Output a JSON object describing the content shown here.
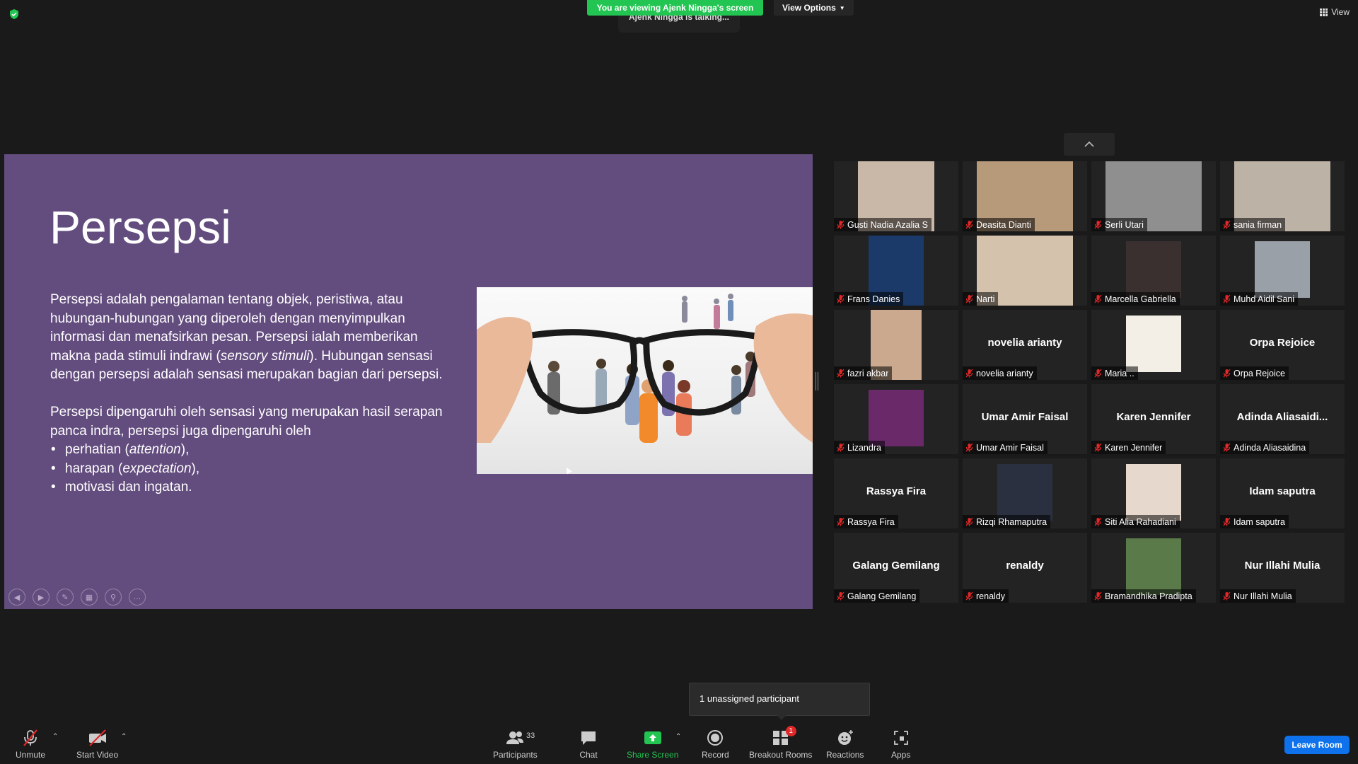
{
  "top": {
    "viewing_banner": "You are viewing Ajenk Ningga's screen",
    "view_options": "View Options",
    "talking": "Ajenk Ningga is talking...",
    "view_label": "View"
  },
  "slide": {
    "title": "Persepsi",
    "para1_a": "Persepsi adalah pengalaman tentang objek, peristiwa, atau hubungan-hubungan yang diperoleh dengan menyimpulkan informasi dan menafsirkan pesan. Persepsi ialah memberikan makna pada stimuli indrawi (",
    "para1_em": "sensory stimuli",
    "para1_b": "). Hubungan sensasi dengan persepsi adalah sensasi merupakan bagian dari persepsi.",
    "para2": "Persepsi dipengaruhi oleh sensasi yang merupakan hasil serapan panca indra, persepsi juga dipengaruhi oleh",
    "bullets": [
      {
        "a": "perhatian (",
        "em": "attention",
        "b": "),"
      },
      {
        "a": "harapan (",
        "em": "expectation",
        "b": "),"
      },
      {
        "a": "motivasi dan ingatan.",
        "em": "",
        "b": ""
      }
    ]
  },
  "gallery": {
    "tiles": [
      {
        "label": "Gusti Nadia Azalia S",
        "center": ""
      },
      {
        "label": "Deasita Dianti",
        "center": ""
      },
      {
        "label": "Serli Utari",
        "center": ""
      },
      {
        "label": "sania firman",
        "center": ""
      },
      {
        "label": "Frans Danies",
        "center": ""
      },
      {
        "label": "Narti",
        "center": ""
      },
      {
        "label": "Marcella Gabriella",
        "center": ""
      },
      {
        "label": "Muhd Aidil Sani",
        "center": ""
      },
      {
        "label": "fazri akbar",
        "center": ""
      },
      {
        "label": "novelia arianty",
        "center": "novelia arianty"
      },
      {
        "label": "Maria ..",
        "center": ""
      },
      {
        "label": "Orpa Rejoice",
        "center": "Orpa Rejoice"
      },
      {
        "label": "Lizandra",
        "center": ""
      },
      {
        "label": "Umar Amir Faisal",
        "center": "Umar Amir Faisal"
      },
      {
        "label": "Karen Jennifer",
        "center": "Karen Jennifer"
      },
      {
        "label": "Adinda Aliasaidina",
        "center": "Adinda  Aliasaidi..."
      },
      {
        "label": "Rassya Fira",
        "center": "Rassya Fira"
      },
      {
        "label": "Rizqi Rhamaputra",
        "center": ""
      },
      {
        "label": "Siti Alia Rahadiani",
        "center": ""
      },
      {
        "label": "Idam saputra",
        "center": "Idam saputra"
      },
      {
        "label": "Galang Gemilang",
        "center": "Galang Gemilang"
      },
      {
        "label": "renaldy",
        "center": "renaldy"
      },
      {
        "label": "Bramandhika Pradipta",
        "center": ""
      },
      {
        "label": "Nur Illahi Mulia",
        "center": "Nur Illahi Mulia"
      }
    ]
  },
  "tooltip": "1 unassigned participant",
  "toolbar": {
    "unmute": "Unmute",
    "start_video": "Start Video",
    "participants": "Participants",
    "participants_count": "33",
    "chat": "Chat",
    "share_screen": "Share Screen",
    "record": "Record",
    "breakout_rooms": "Breakout Rooms",
    "breakout_badge": "1",
    "reactions": "Reactions",
    "apps": "Apps",
    "leave_room": "Leave Room"
  },
  "colors": {
    "banner_green": "#23c552",
    "slide_purple": "#634c7e",
    "leave_blue": "#0e72ed",
    "muted_red": "#e02828"
  }
}
